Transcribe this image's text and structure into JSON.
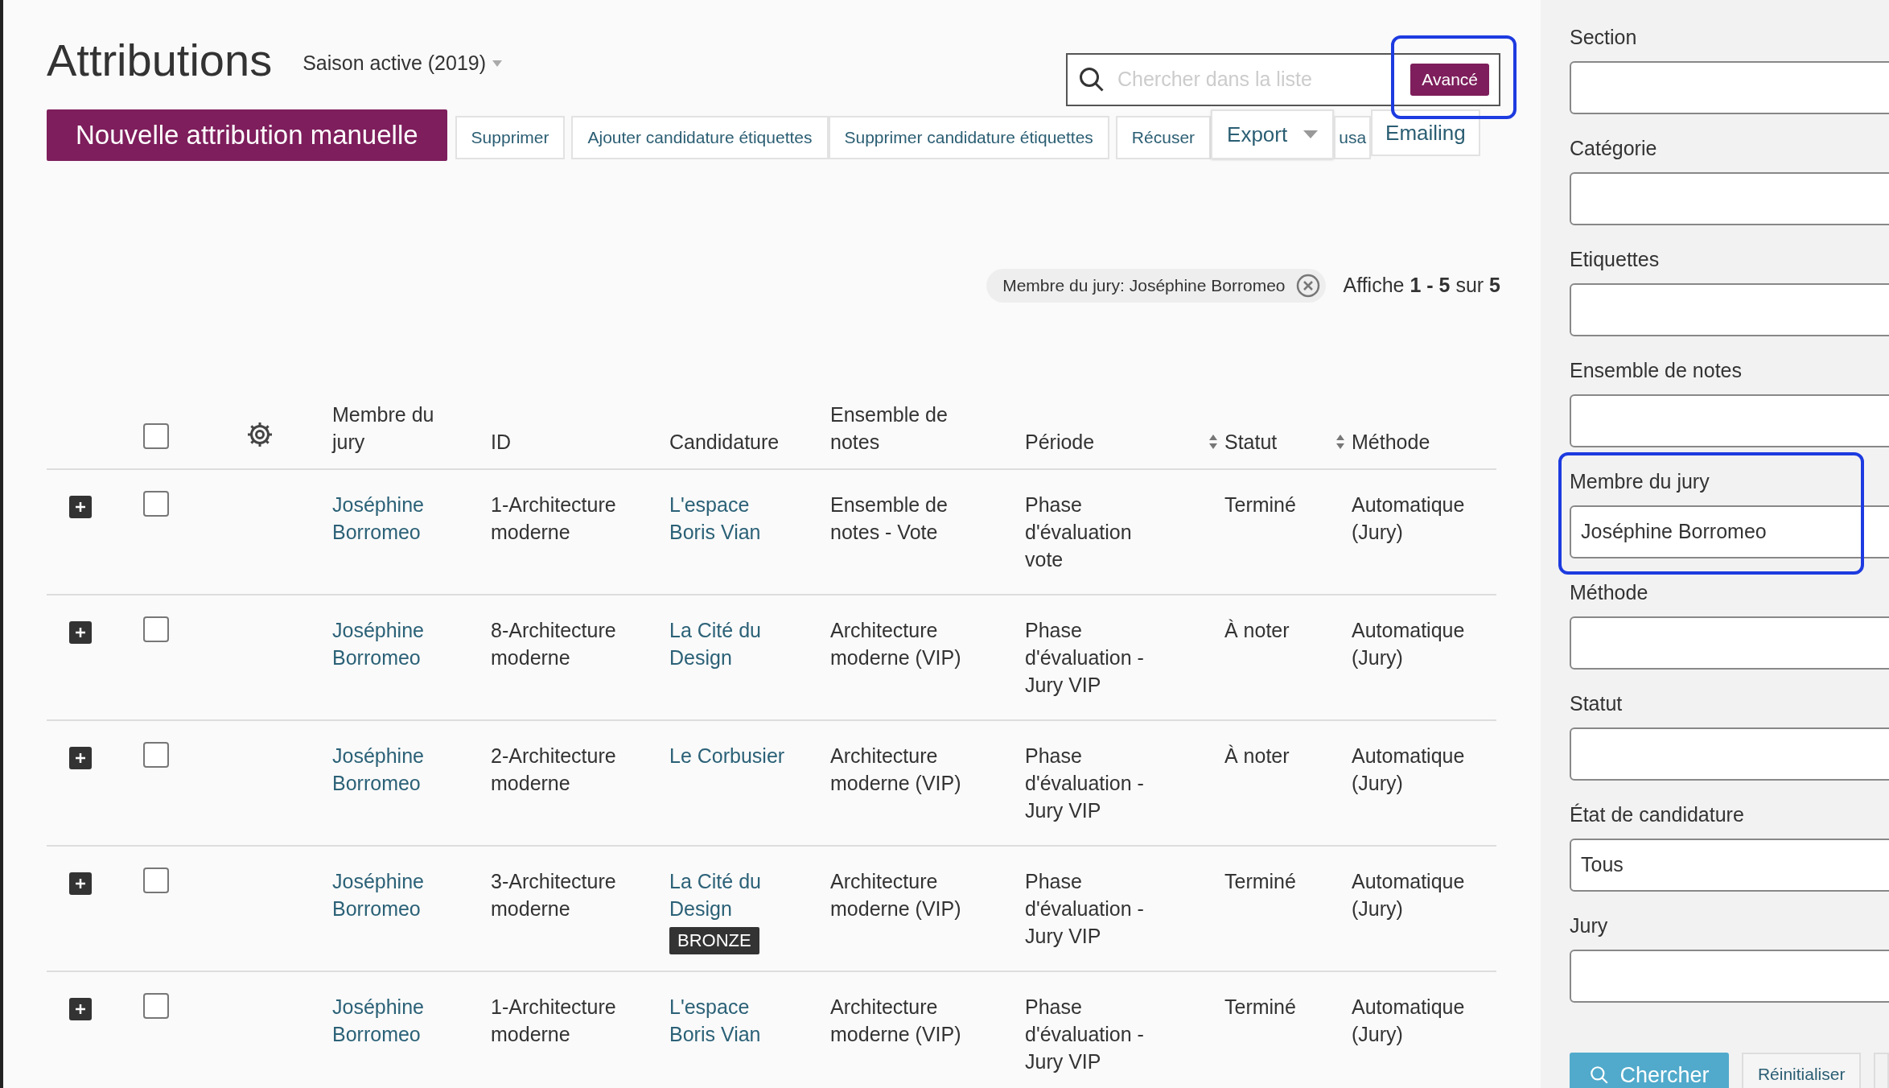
{
  "header": {
    "title": "Attributions",
    "season": "Saison active (2019)"
  },
  "search": {
    "placeholder": "Chercher dans la liste",
    "advanced_button": "Avancé"
  },
  "toolbar": {
    "primary": "Nouvelle attribution manuelle",
    "buttons": [
      "Supprimer",
      "Ajouter candidature étiquettes",
      "Supprimer candidature étiquettes",
      "Récuser"
    ],
    "export": "Export",
    "hidden_button": "usa",
    "emailing": "Emailing"
  },
  "filter_chip": "Membre du jury: Joséphine Borromeo",
  "count": "Affiche **1 - 5** sur **5**",
  "table": {
    "select_all_checked": false,
    "columns": [
      {
        "label": "Membre du jury",
        "sortable": false
      },
      {
        "label": "ID",
        "sortable": false
      },
      {
        "label": "Candidature",
        "sortable": false
      },
      {
        "label": "Ensemble de notes",
        "sortable": false
      },
      {
        "label": "Période",
        "sortable": false
      },
      {
        "label": "Statut",
        "sortable": true
      },
      {
        "label": "Méthode",
        "sortable": true
      }
    ],
    "rows": [
      {
        "checked": false,
        "jury": "Joséphine Borromeo",
        "id": "1-Architecture moderne",
        "candidature": "L'espace Boris Vian",
        "notes": "Ensemble de notes - Vote",
        "periode": "Phase d'évaluation vote",
        "statut": "Terminé",
        "methode": "Automatique (Jury)"
      },
      {
        "checked": false,
        "jury": "Joséphine Borromeo",
        "id": "8-Architecture moderne",
        "candidature": "La Cité du Design",
        "notes": "Architecture moderne (VIP)",
        "periode": "Phase d'évaluation - Jury VIP",
        "statut": "À noter",
        "methode": "Automatique (Jury)"
      },
      {
        "checked": false,
        "jury": "Joséphine Borromeo",
        "id": "2-Architecture moderne",
        "candidature": "Le Corbusier",
        "notes": "Architecture moderne (VIP)",
        "periode": "Phase d'évaluation - Jury VIP",
        "statut": "À noter",
        "methode": "Automatique (Jury)"
      },
      {
        "checked": false,
        "jury": "Joséphine Borromeo",
        "id": "3-Architecture moderne",
        "candidature": "La Cité du Design",
        "badge": "BRONZE",
        "notes": "Architecture moderne (VIP)",
        "periode": "Phase d'évaluation - Jury VIP",
        "statut": "Terminé",
        "methode": "Automatique (Jury)"
      },
      {
        "checked": false,
        "jury": "Joséphine Borromeo",
        "id": "1-Architecture moderne",
        "candidature": "L'espace Boris Vian",
        "notes": "Architecture moderne (VIP)",
        "periode": "Phase d'évaluation - Jury VIP",
        "statut": "Terminé",
        "methode": "Automatique (Jury)"
      }
    ]
  },
  "filters": [
    {
      "label": "Section",
      "highlighted": false
    },
    {
      "label": "Catégorie",
      "highlighted": false
    },
    {
      "label": "Etiquettes",
      "highlighted": false
    },
    {
      "label": "Ensemble de notes",
      "highlighted": false
    },
    {
      "label": "Membre du jury",
      "value": "Joséphine Borromeo",
      "highlighted": true
    },
    {
      "label": "Méthode",
      "highlighted": false
    },
    {
      "label": "Statut",
      "highlighted": false
    },
    {
      "label": "État de candidature",
      "value": "Tous",
      "highlighted": false
    },
    {
      "label": "Jury",
      "highlighted": false
    }
  ],
  "filter_buttons": {
    "search": "Chercher",
    "reset": "Réinitialiser"
  }
}
